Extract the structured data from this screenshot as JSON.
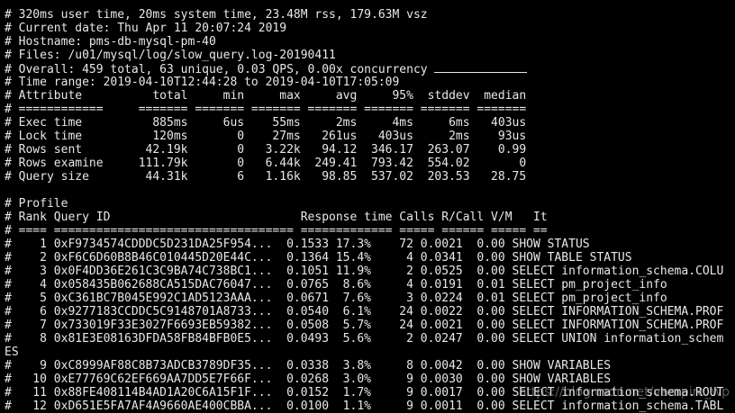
{
  "terminal": {
    "header": [
      "# 320ms user time, 20ms system time, 23.48M rss, 179.63M vsz",
      "# Current date: Thu Apr 11 20:07:24 2019",
      "# Hostname: pms-db-mysql-pm-40",
      "# Files: /u01/mysql/log/slow_query.log-20190411",
      "# Overall: 459 total, 63 unique, 0.03 QPS, 0.00x concurrency ",
      "# Time range: 2019-04-10T12:44:28 to 2019-04-10T17:05:09"
    ],
    "attr_header": "# Attribute          total     min     max     avg     95%  stddev  median",
    "attr_sep": "# ============     ======= ======= ======= ======= ======= ======= =======",
    "attr_rows": [
      "# Exec time          885ms     6us    55ms     2ms     4ms     6ms   403us",
      "# Lock time          120ms       0    27ms   261us   403us     2ms    93us",
      "# Rows sent         42.19k       0   3.22k   94.12  346.17  263.07    0.99",
      "# Rows examine     111.79k       0   6.44k  249.41  793.42  554.02       0",
      "# Query size        44.31k       6   1.16k   98.85  537.02  203.53   28.75"
    ],
    "blank": "",
    "profile_title": "# Profile",
    "profile_header": "# Rank Query ID                           Response time Calls R/Call V/M   It",
    "profile_sep": "# ==== ================================== ============= ===== ====== ===== ==",
    "profile_rows": [
      "#    1 0xF9734574CDDDC5D231DA25F954...  0.1533 17.3%    72 0.0021  0.00 SHOW STATUS",
      "#    2 0xF6C6D60B8B46C010445D20E44C...  0.1364 15.4%     4 0.0341  0.00 SHOW TABLE STATUS",
      "#    3 0x0F4DD36E261C3C9BA74C738BC1...  0.1051 11.9%     2 0.0525  0.00 SELECT information_schema.COLU",
      "#    4 0x058435B062688CA515DAC76047...  0.0765  8.6%     4 0.0191  0.01 SELECT pm_project_info",
      "#    5 0xC361BC7B045E992C1AD5123AAA...  0.0671  7.6%     3 0.0224  0.01 SELECT pm_project_info",
      "#    6 0x9277183CCDDC5C9148701A8733...  0.0540  6.1%    24 0.0022  0.00 SELECT INFORMATION_SCHEMA.PROF",
      "#    7 0x733019F33E3027F6693EB59382...  0.0508  5.7%    24 0.0021  0.00 SELECT INFORMATION_SCHEMA.PROF",
      "#    8 0x81E3E08163DFDA58FB84BFB0E5...  0.0493  5.6%     2 0.0247  0.00 SELECT UNION information_schem",
      "ES",
      "#    9 0xC8999AF88C8B73ADCB3789DF35...  0.0338  3.8%     8 0.0042  0.00 SHOW VARIABLES",
      "#   10 0xE77769C62EF669AA7DD5E7F66F...  0.0268  3.0%     9 0.0030  0.00 SHOW VARIABLES",
      "#   11 0x88FE408114B4AD1A20C6A15F1F...  0.0152  1.7%     9 0.0017  0.00 SELECT information_schema.ROUT",
      "#   12 0xD651E5FA7AF4A9660AE400CBBA...  0.0100  1.1%     9 0.0011  0.00 SELECT information_schema.TABL"
    ],
    "watermark": "https://blog.csdn.net/vampire_wp"
  }
}
